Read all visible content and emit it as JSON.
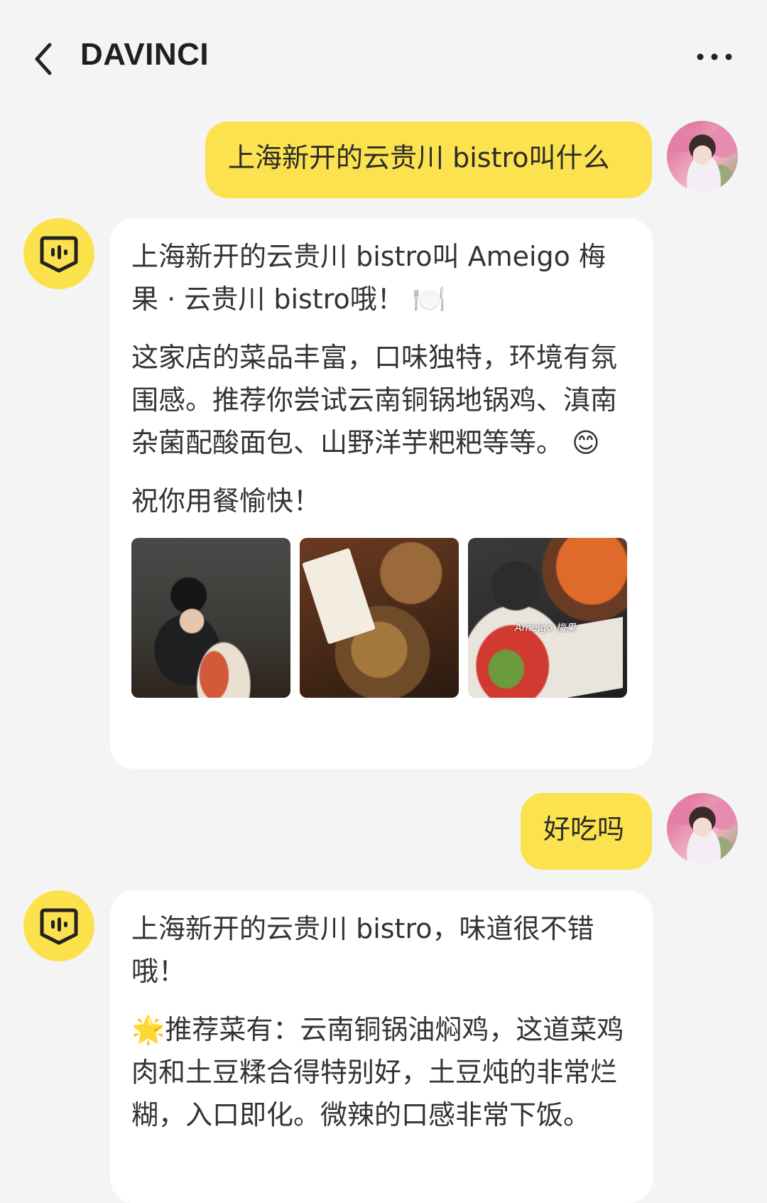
{
  "header": {
    "title": "DAVINCI"
  },
  "messages": [
    {
      "role": "user",
      "text": "上海新开的云贵川 bistro叫什么"
    },
    {
      "role": "assistant",
      "paragraphs": [
        " 上海新开的云贵川 bistro叫 Ameigo 梅果 · 云贵川 bistro哦！ 🍽️",
        "这家店的菜品丰富，口味独特，环境有氛围感。推荐你尝试云南铜锅地锅鸡、滇南杂菌配酸面包、山野洋芋粑粑等等。 😊",
        "祝你用餐愉快！"
      ],
      "photo_caption": "Ameigo 梅果"
    },
    {
      "role": "user",
      "text": "好吃吗"
    },
    {
      "role": "assistant",
      "paragraphs": [
        " 上海新开的云贵川 bistro，味道很不错哦！",
        "🌟推荐菜有：云南铜锅油焖鸡，这道菜鸡肉和土豆糅合得特别好，土豆炖的非常烂糊，入口即化。微辣的口感非常下饭。"
      ]
    }
  ]
}
